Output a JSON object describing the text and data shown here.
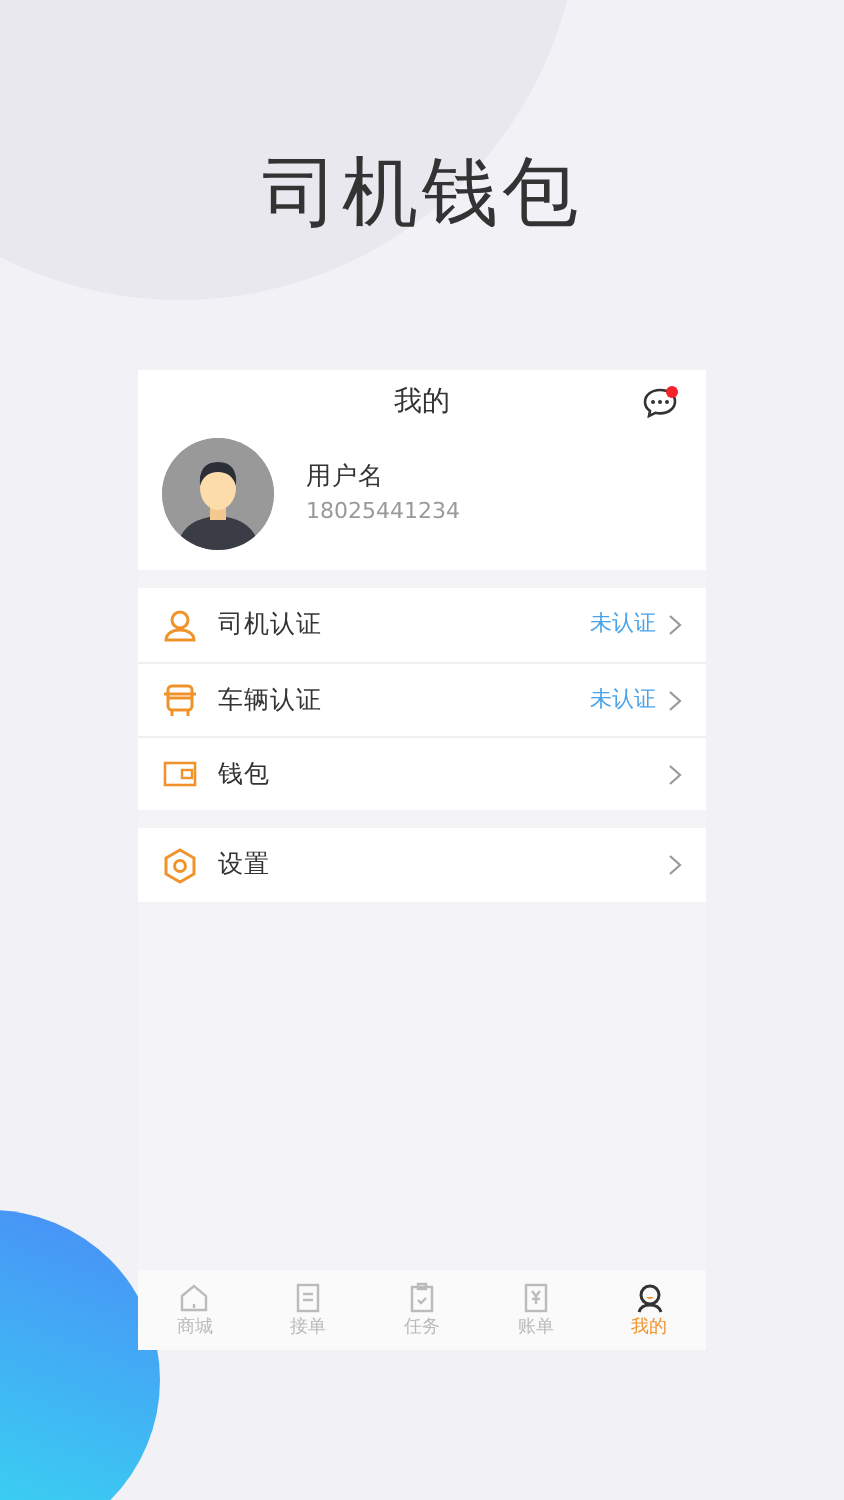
{
  "headline": "司机钱包",
  "header": {
    "title": "我的",
    "has_unread": true
  },
  "profile": {
    "name": "用户名",
    "phone": "18025441234"
  },
  "menu_groups": [
    {
      "items": [
        {
          "kind": "driver",
          "label": "司机认证",
          "status": "未认证"
        },
        {
          "kind": "vehicle",
          "label": "车辆认证",
          "status": "未认证"
        },
        {
          "kind": "wallet",
          "label": "钱包"
        }
      ]
    },
    {
      "items": [
        {
          "kind": "settings",
          "label": "设置"
        }
      ]
    }
  ],
  "tabs": [
    {
      "kind": "home",
      "label": "商城",
      "selected": false
    },
    {
      "kind": "list",
      "label": "接单",
      "selected": false
    },
    {
      "kind": "task",
      "label": "任务",
      "selected": false
    },
    {
      "kind": "bill",
      "label": "账单",
      "selected": false
    },
    {
      "kind": "user",
      "label": "我的",
      "selected": true
    }
  ]
}
